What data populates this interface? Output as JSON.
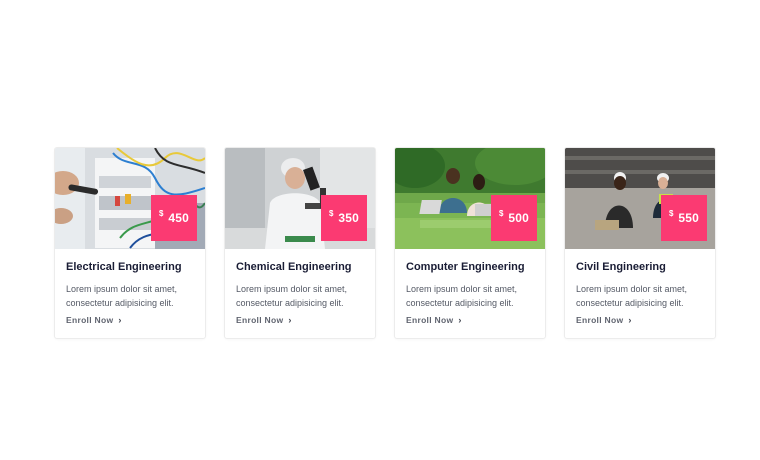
{
  "courses": [
    {
      "title": "Electrical Engineering",
      "description": "Lorem ipsum dolor sit amet, consectetur adipisicing elit.",
      "currency": "$",
      "price": "450",
      "cta": "Enroll Now",
      "image": "electrical-panel-photo"
    },
    {
      "title": "Chemical Engineering",
      "description": "Lorem ipsum dolor sit amet, consectetur adipisicing elit.",
      "currency": "$",
      "price": "350",
      "cta": "Enroll Now",
      "image": "lab-microscope-photo"
    },
    {
      "title": "Computer Engineering",
      "description": "Lorem ipsum dolor sit amet, consectetur adipisicing elit.",
      "currency": "$",
      "price": "500",
      "cta": "Enroll Now",
      "image": "students-laptops-park-photo"
    },
    {
      "title": "Civil Engineering",
      "description": "Lorem ipsum dolor sit amet, consectetur adipisicing elit.",
      "currency": "$",
      "price": "550",
      "cta": "Enroll Now",
      "image": "construction-workers-photo"
    }
  ],
  "colors": {
    "price_badge": "#fb3a72",
    "title": "#1a1d35",
    "body_text": "#555a66",
    "link": "#616570"
  },
  "icons": {
    "cta": "chevron-right-icon"
  }
}
